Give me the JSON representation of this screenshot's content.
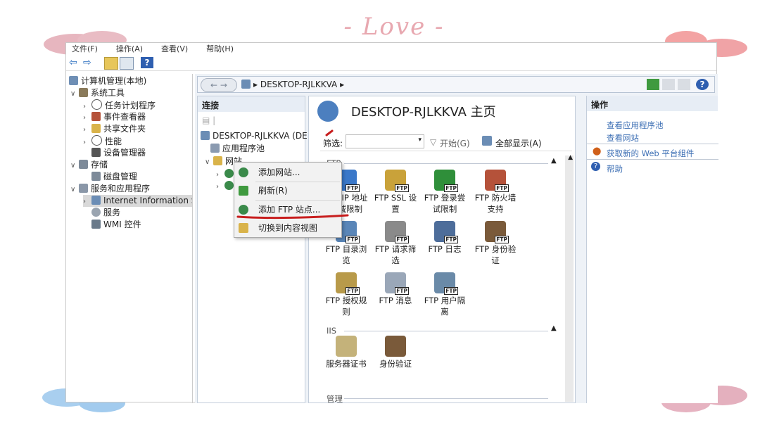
{
  "decor": {
    "love_text": "- Love -"
  },
  "menubar": [
    "文件(F)",
    "操作(A)",
    "查看(V)",
    "帮助(H)"
  ],
  "tree": {
    "root": "计算机管理(本地)",
    "system_tools": "系统工具",
    "task_scheduler": "任务计划程序",
    "event_viewer": "事件查看器",
    "shared_folders": "共享文件夹",
    "performance": "性能",
    "device_manager": "设备管理器",
    "storage": "存储",
    "disk_management": "磁盘管理",
    "services_apps": "服务和应用程序",
    "iis": "Internet Information S",
    "services": "服务",
    "wmi": "WMI 控件"
  },
  "address": {
    "crumb": "DESKTOP-RJLKKVA",
    "sep": "▸"
  },
  "connections": {
    "title": "连接",
    "server": "DESKTOP-RJLKKVA (DE",
    "app_pools": "应用程序池",
    "sites": "网站"
  },
  "center": {
    "title": "DESKTOP-RJLKKVA 主页",
    "filter_label": "筛选:",
    "start_label": "开始(G)",
    "show_all_label": "全部显示(A)",
    "sections": {
      "ftp": "FTP",
      "iis": "IIS",
      "manage": "管理"
    },
    "features_ftp": [
      {
        "label": "FTP IP 地址和域限制",
        "color": "#3a78c9"
      },
      {
        "label": "FTP SSL 设置",
        "color": "#c9a23a"
      },
      {
        "label": "FTP 登录尝试限制",
        "color": "#2f8f3a"
      },
      {
        "label": "FTP 防火墙支持",
        "color": "#b5523a"
      },
      {
        "label": "FTP 目录浏览",
        "color": "#5a86b8"
      },
      {
        "label": "FTP 请求筛选",
        "color": "#8a8a8a"
      },
      {
        "label": "FTP 日志",
        "color": "#4d6d9a"
      },
      {
        "label": "FTP 身份验证",
        "color": "#7a5a3a"
      },
      {
        "label": "FTP 授权规则",
        "color": "#b89a4a"
      },
      {
        "label": "FTP 消息",
        "color": "#9aa7b8"
      },
      {
        "label": "FTP 用户隔离",
        "color": "#6a8aa8"
      }
    ],
    "features_iis": [
      {
        "label": "服务器证书",
        "color": "#c4b27a"
      },
      {
        "label": "身份验证",
        "color": "#7a5a3a"
      }
    ]
  },
  "context_menu": {
    "items": [
      "添加网站...",
      "刷新(R)",
      "添加 FTP 站点...",
      "切换到内容视图"
    ]
  },
  "actions": {
    "title": "操作",
    "links": [
      "查看应用程序池",
      "查看网站",
      "获取新的 Web 平台组件",
      "帮助"
    ]
  }
}
